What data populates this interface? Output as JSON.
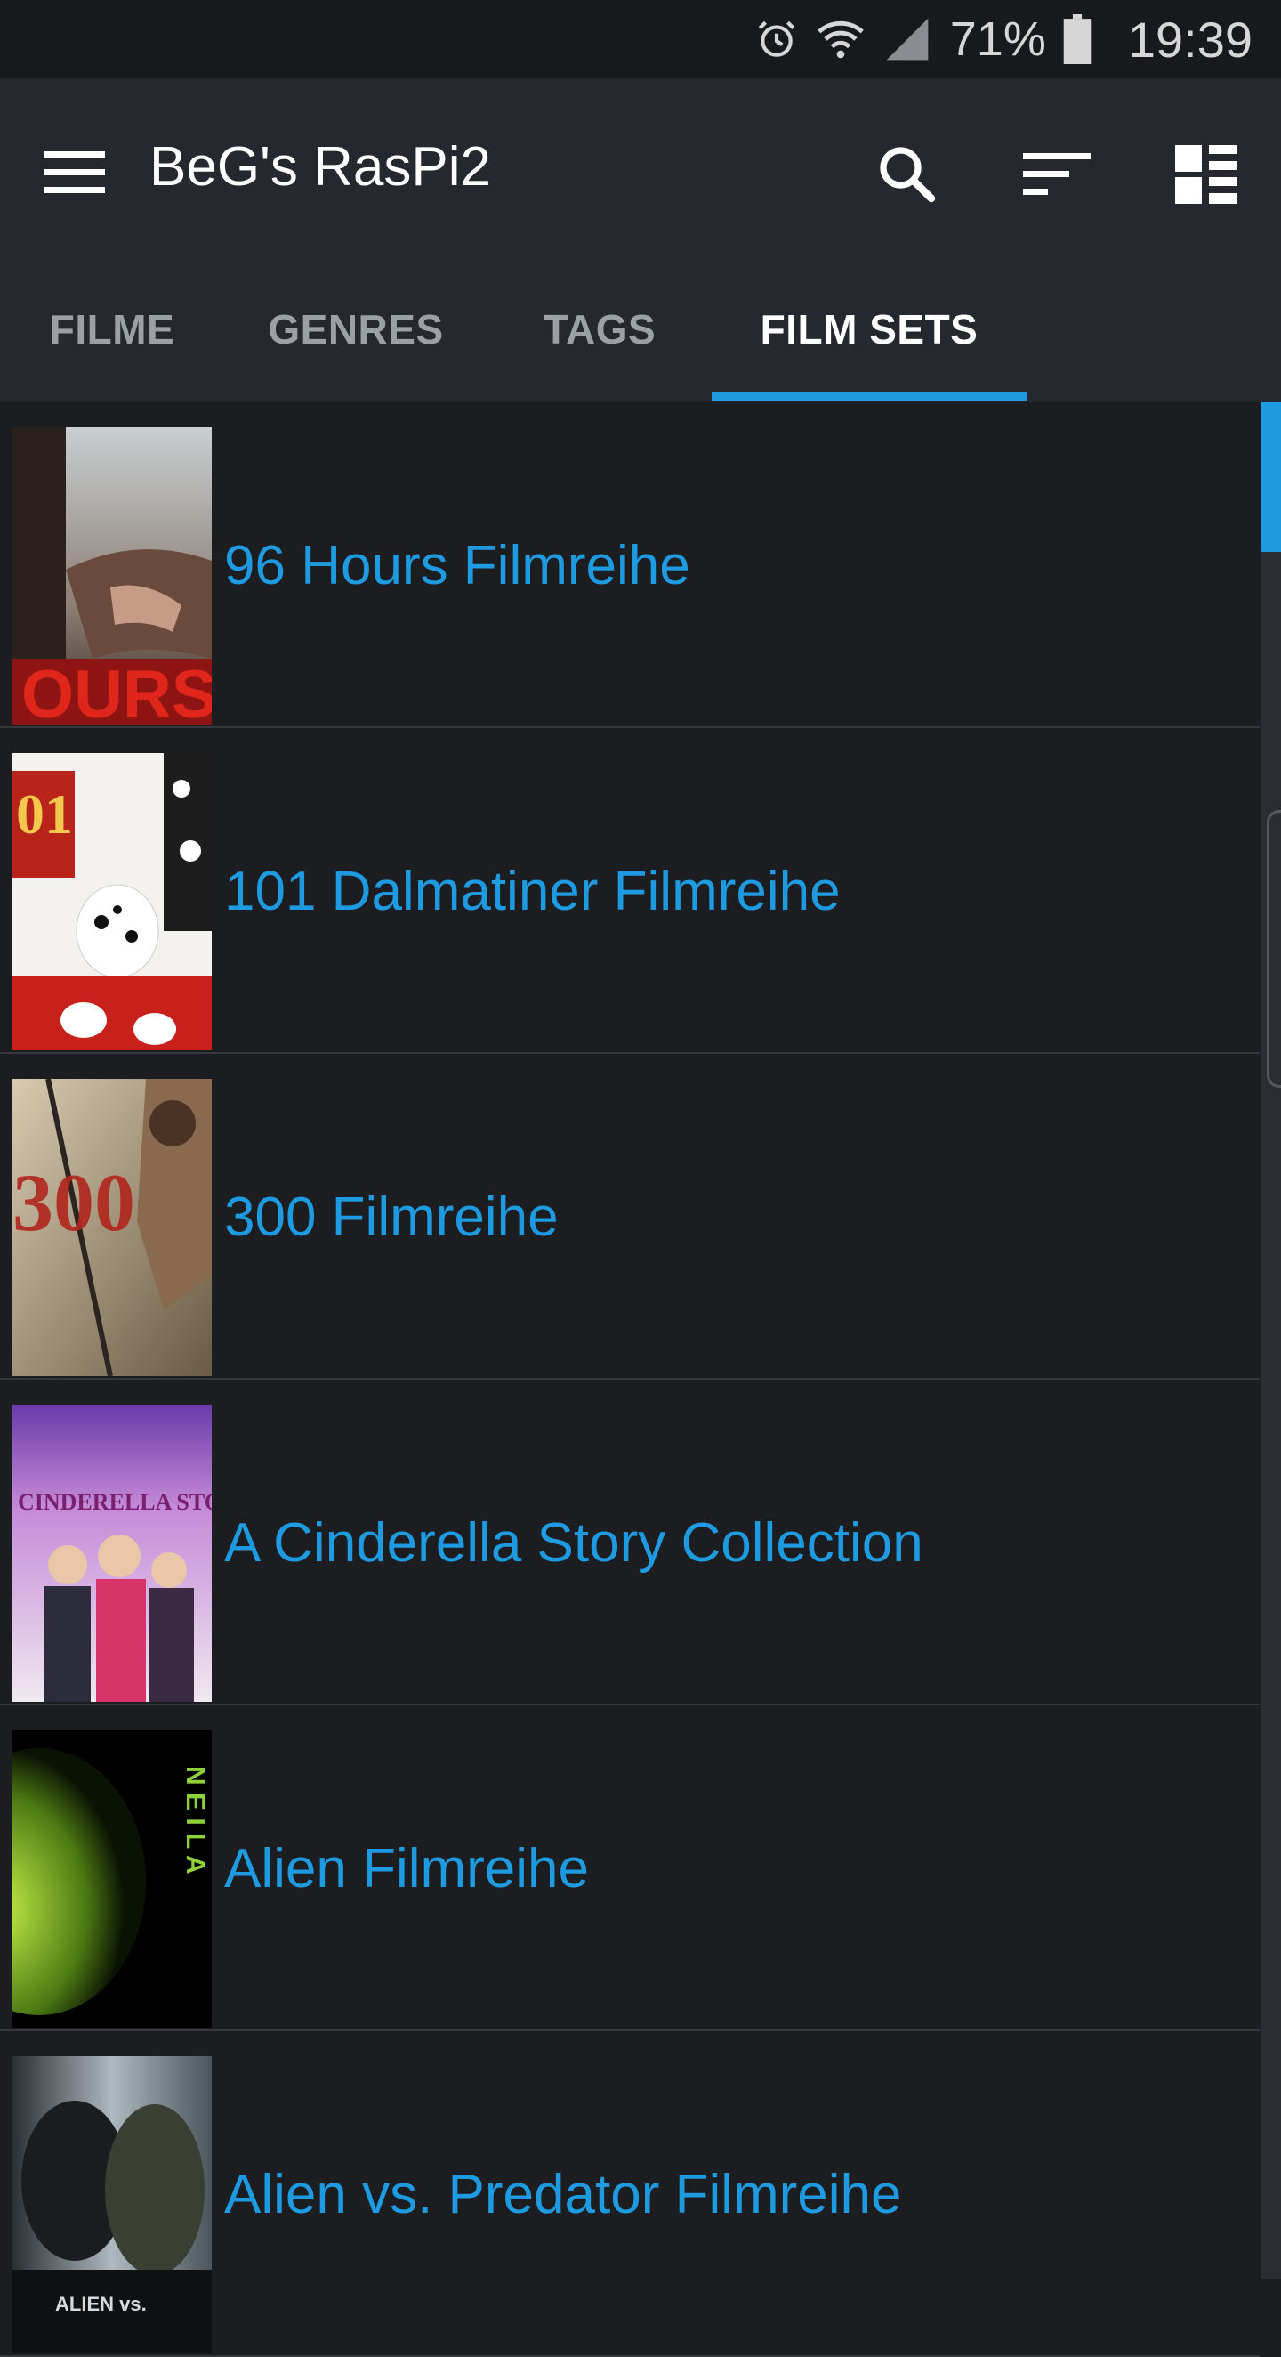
{
  "status_bar": {
    "battery": "71%",
    "time": "19:39",
    "icons": [
      "alarm-icon",
      "wifi-icon",
      "signal-icon",
      "battery-icon"
    ]
  },
  "app_bar": {
    "title": "BeG's RasPi2",
    "icons": [
      "menu-icon",
      "search-icon",
      "sort-icon",
      "view-mode-icon"
    ]
  },
  "tabs": [
    {
      "label": "FILME"
    },
    {
      "label": "GENRES"
    },
    {
      "label": "TAGS"
    },
    {
      "label": "FILM SETS"
    }
  ],
  "active_tab": "FILM SETS",
  "colors": {
    "accent": "#1e9be0",
    "app_bar": "#25282e",
    "background": "#1b1d21"
  },
  "film_sets": [
    {
      "title": "96 Hours Filmreihe"
    },
    {
      "title": "101 Dalmatiner Filmreihe"
    },
    {
      "title": "300 Filmreihe"
    },
    {
      "title": "A Cinderella Story Collection"
    },
    {
      "title": "Alien Filmreihe"
    },
    {
      "title": "Alien vs. Predator Filmreihe"
    }
  ]
}
